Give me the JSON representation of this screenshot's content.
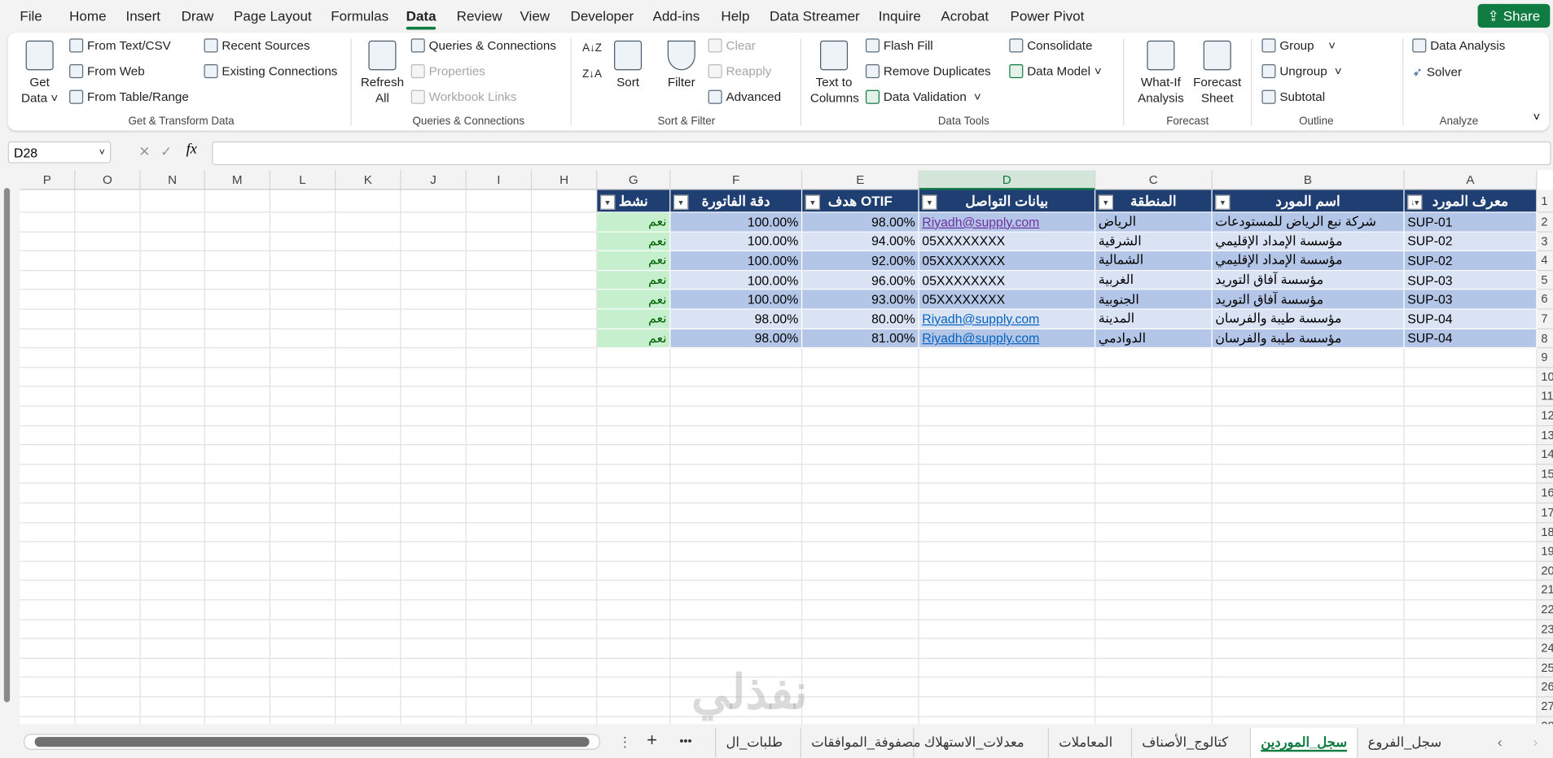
{
  "menu": {
    "items": [
      "File",
      "Home",
      "Insert",
      "Draw",
      "Page Layout",
      "Formulas",
      "Data",
      "Review",
      "View",
      "Developer",
      "Add-ins",
      "Help",
      "Data Streamer",
      "Inquire",
      "Acrobat",
      "Power Pivot"
    ],
    "active": "Data",
    "share": "Share"
  },
  "ribbon": {
    "get_transform": {
      "get_data": "Get Data",
      "from_text": "From Text/CSV",
      "from_web": "From Web",
      "from_table": "From Table/Range",
      "recent": "Recent Sources",
      "existing": "Existing Connections",
      "label": "Get & Transform Data"
    },
    "queries": {
      "refresh": "Refresh All",
      "qc": "Queries & Connections",
      "properties": "Properties",
      "links": "Workbook Links",
      "label": "Queries & Connections"
    },
    "sort_filter": {
      "sort": "Sort",
      "filter": "Filter",
      "clear": "Clear",
      "reapply": "Reapply",
      "advanced": "Advanced",
      "label": "Sort & Filter"
    },
    "data_tools": {
      "text_to_columns": "Text to Columns",
      "flash_fill": "Flash Fill",
      "remove_dup": "Remove Duplicates",
      "validation": "Data Validation",
      "consolidate": "Consolidate",
      "data_model": "Data Model",
      "label": "Data Tools"
    },
    "forecast": {
      "what_if": "What-If Analysis",
      "forecast_sheet": "Forecast Sheet",
      "label": "Forecast"
    },
    "outline": {
      "group": "Group",
      "ungroup": "Ungroup",
      "subtotal": "Subtotal",
      "label": "Outline"
    },
    "analyze": {
      "data_analysis": "Data Analysis",
      "solver": "Solver",
      "label": "Analyze"
    }
  },
  "formula_bar": {
    "name_box": "D28",
    "fx": "fx",
    "value": ""
  },
  "columns": [
    "A",
    "B",
    "C",
    "D",
    "E",
    "F",
    "G",
    "H",
    "I",
    "J",
    "K",
    "L",
    "M",
    "N",
    "O",
    "P"
  ],
  "selected_column": "D",
  "table": {
    "headers": [
      "معرف المورد",
      "اسم المورد",
      "المنطقة",
      "بيانات التواصل",
      "هدف OTIF",
      "دقة الفاتورة",
      "نشط"
    ],
    "rows": [
      [
        "SUP-01",
        "شركة نبع الرياض للمستودعات",
        "الرياض",
        "Riyadh@supply.com",
        "98.00%",
        "100.00%",
        "نعم"
      ],
      [
        "SUP-02",
        "مؤسسة الإمداد الإقليمي",
        "الشرقية",
        "05XXXXXXXX",
        "94.00%",
        "100.00%",
        "نعم"
      ],
      [
        "SUP-02",
        "مؤسسة الإمداد الإقليمي",
        "الشمالية",
        "05XXXXXXXX",
        "92.00%",
        "100.00%",
        "نعم"
      ],
      [
        "SUP-03",
        "مؤسسة آفاق التوريد",
        "الغربية",
        "05XXXXXXXX",
        "96.00%",
        "100.00%",
        "نعم"
      ],
      [
        "SUP-03",
        "مؤسسة آفاق التوريد",
        "الجنوبية",
        "05XXXXXXXX",
        "93.00%",
        "100.00%",
        "نعم"
      ],
      [
        "SUP-04",
        "مؤسسة طيبة والفرسان",
        "المدينة",
        "Riyadh@supply.com",
        "80.00%",
        "98.00%",
        "نعم"
      ],
      [
        "SUP-04",
        "مؤسسة طيبة والفرسان",
        "الدوادمي",
        "Riyadh@supply.com",
        "81.00%",
        "98.00%",
        "نعم"
      ]
    ]
  },
  "colors": {
    "header": "#1f3f73",
    "band1": "#b4c6e7",
    "band2": "#dae3f3",
    "active_fill": "#c6efce",
    "active_text": "#006100",
    "link": "#0563c1",
    "visited": "#7030a0",
    "accent": "#107c41"
  },
  "sheet_tabs": [
    "سجل_الفروع",
    "سجل_الموردين",
    "كتالوج_الأصناف",
    "المعاملات",
    "معدلات_الاستهلاك",
    "مصفوفة_الموافقات",
    "طلبات_ال"
  ],
  "active_tab": "سجل_الموردين",
  "watermark": "نفذلي"
}
